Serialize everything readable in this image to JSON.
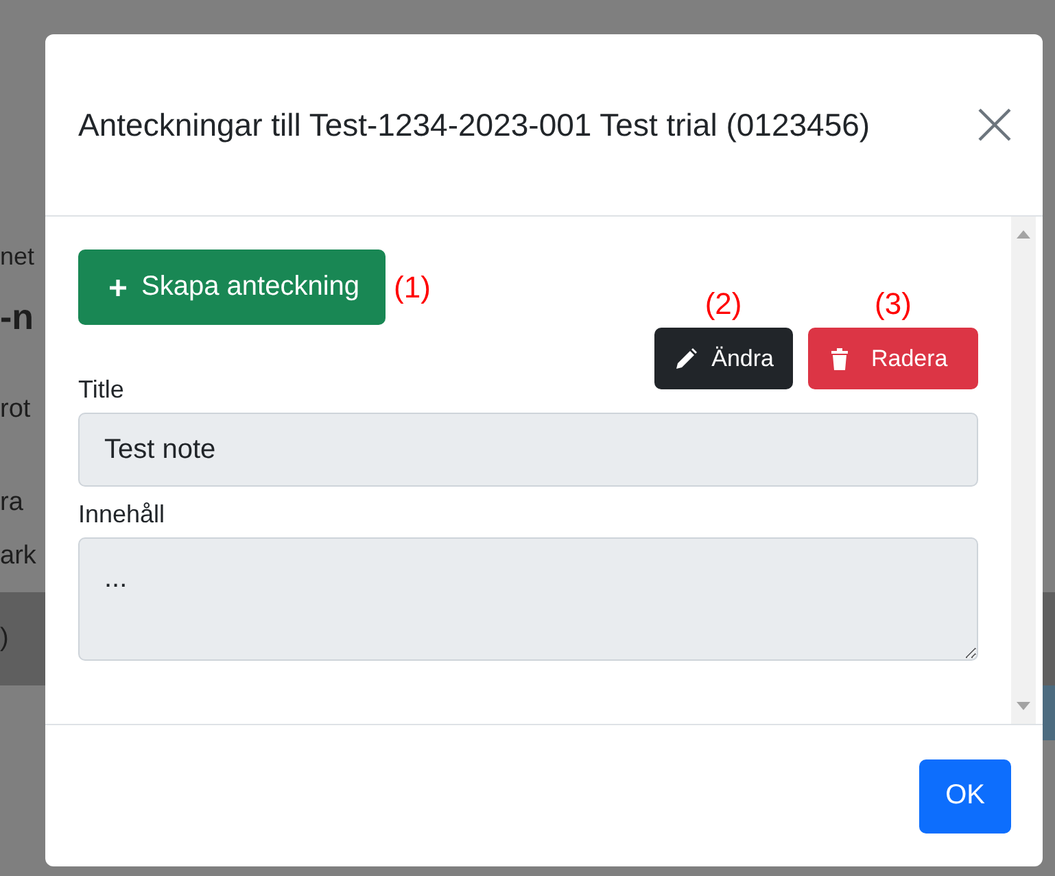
{
  "background_fragments": [
    "net",
    "-n",
    "rot",
    "ra",
    "ark",
    ")"
  ],
  "dialog": {
    "title": "Anteckningar till Test-1234-2023-001 Test trial (0123456)",
    "create_button": {
      "label": "Skapa anteckning",
      "annotation": "(1)"
    },
    "actions": [
      {
        "kind": "edit",
        "label": "Ändra",
        "annotation": "(2)"
      },
      {
        "kind": "delete",
        "label": "Radera",
        "annotation": "(3)"
      }
    ],
    "fields": [
      {
        "kind": "input",
        "label": "Title",
        "value": "Test note",
        "disabled": true
      },
      {
        "kind": "textarea",
        "label": "Innehåll",
        "value": "...",
        "disabled": true
      }
    ],
    "footer_button": "OK"
  }
}
